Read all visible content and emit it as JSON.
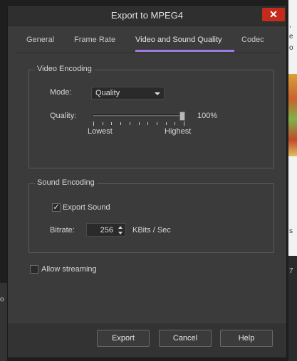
{
  "background": {
    "right_texts": [
      ", ",
      "e",
      "o",
      "7",
      "s"
    ],
    "left_text": "o"
  },
  "dialog": {
    "title": "Export to MPEG4",
    "close_symbol": "✕",
    "tabs": [
      {
        "label": "General",
        "active": false
      },
      {
        "label": "Frame Rate",
        "active": false
      },
      {
        "label": "Video and Sound Quality",
        "active": true
      },
      {
        "label": "Codec",
        "active": false
      }
    ],
    "accent_color": "#9e7be0",
    "close_color": "#c42b1c"
  },
  "video": {
    "group_label": "Video Encoding",
    "mode_label": "Mode:",
    "mode_value": "Quality",
    "quality_label": "Quality:",
    "quality_value": "100%",
    "quality_fraction": 1.0,
    "slider_min_label": "Lowest",
    "slider_max_label": "Highest"
  },
  "sound": {
    "group_label": "Sound Encoding",
    "export_sound_label": "Export Sound",
    "export_sound_checked": true,
    "checkmark": "✓",
    "bitrate_label": "Bitrate:",
    "bitrate_value": "256",
    "bitrate_unit": "KBits / Sec"
  },
  "streaming": {
    "label": "Allow streaming",
    "checked": false
  },
  "buttons": {
    "export": "Export",
    "cancel": "Cancel",
    "help": "Help"
  }
}
